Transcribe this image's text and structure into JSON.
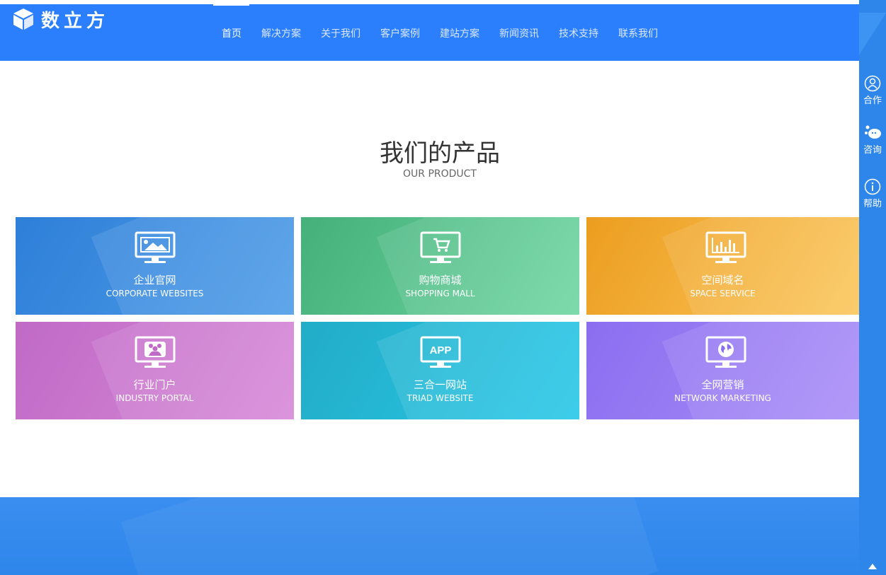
{
  "brand": {
    "name": "数立方",
    "logo_icon": "cube-icon"
  },
  "nav": {
    "items": [
      {
        "label": "首页",
        "active": true
      },
      {
        "label": "解决方案"
      },
      {
        "label": "关于我们"
      },
      {
        "label": "客户案例"
      },
      {
        "label": "建站方案"
      },
      {
        "label": "新闻资讯"
      },
      {
        "label": "技术支持"
      },
      {
        "label": "联系我们"
      }
    ]
  },
  "section": {
    "title": "我们的产品",
    "subtitle": "OUR PRODUCT"
  },
  "products": [
    {
      "cn": "企业官网",
      "en": "CORPORATE WEBSITES",
      "icon": "monitor-image-icon",
      "color": "#2e7fd8"
    },
    {
      "cn": "购物商城",
      "en": "SHOPPING MALL",
      "icon": "monitor-cart-icon",
      "color": "#45b07a"
    },
    {
      "cn": "空间域名",
      "en": "SPACE SERVICE",
      "icon": "monitor-chart-icon",
      "color": "#ec9d1f"
    },
    {
      "cn": "行业门户",
      "en": "INDUSTRY PORTAL",
      "icon": "monitor-people-icon",
      "color": "#c06ac6"
    },
    {
      "cn": "三合一网站",
      "en": "TRIAD WEBSITE",
      "icon": "monitor-app-icon",
      "app_label": "APP",
      "color": "#22acc7"
    },
    {
      "cn": "全网营销",
      "en": "NETWORK MARKETING",
      "icon": "monitor-globe-icon",
      "color": "#8a6ef0"
    }
  ],
  "sidebar": {
    "items": [
      {
        "label": "合作",
        "icon": "user-icon"
      },
      {
        "label": "咨询",
        "icon": "chat-icon"
      },
      {
        "label": "帮助",
        "icon": "info-icon"
      }
    ]
  },
  "colors": {
    "header": "#2b7ffd",
    "sidebar": "#2f86ea",
    "footer": "#3a8ef0"
  }
}
